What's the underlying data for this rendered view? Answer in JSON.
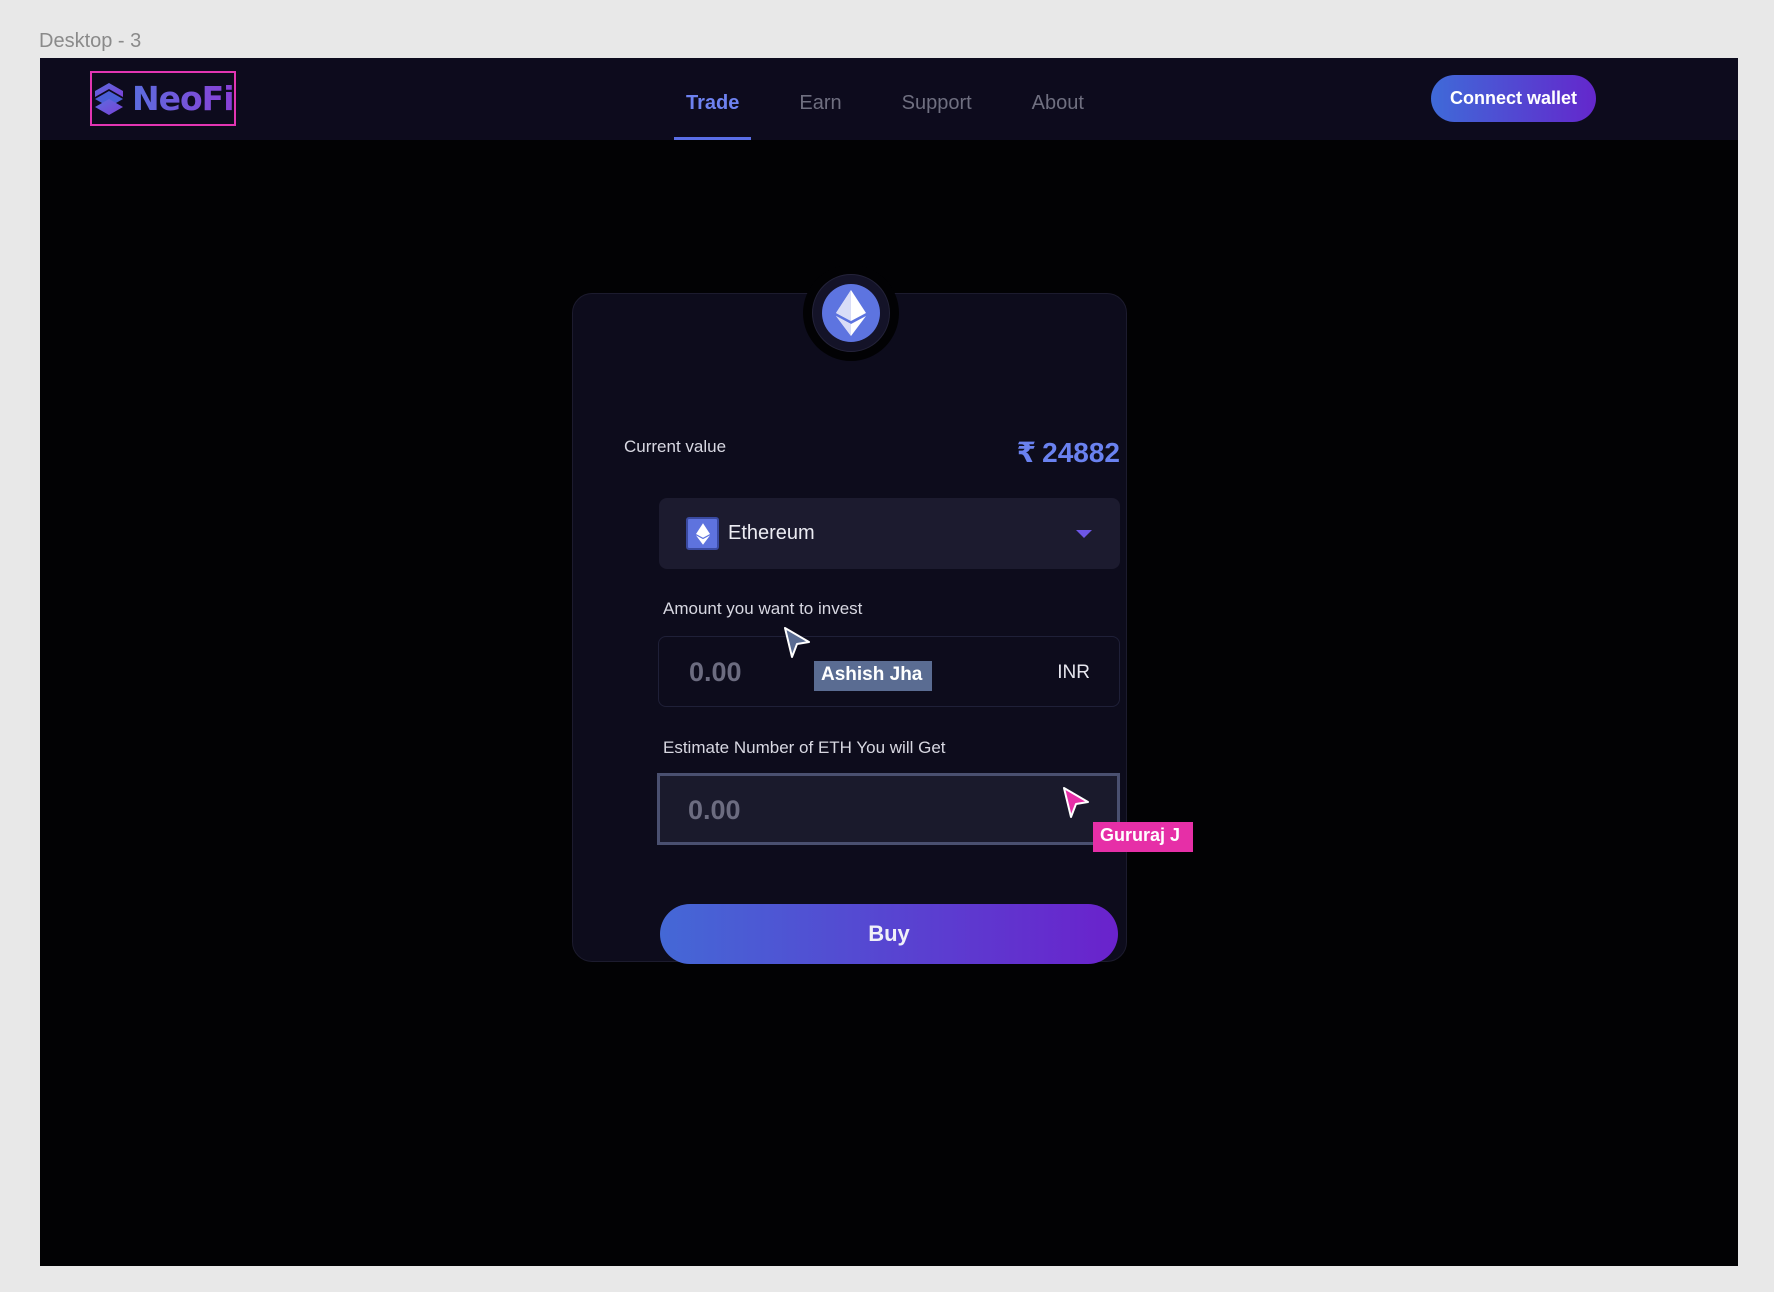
{
  "frame": {
    "label": "Desktop - 3"
  },
  "brand": {
    "name": "NeoFi",
    "accent_color": "#6a5ae0"
  },
  "nav": {
    "tabs": [
      {
        "label": "Trade",
        "active": true
      },
      {
        "label": "Earn",
        "active": false
      },
      {
        "label": "Support",
        "active": false
      },
      {
        "label": "About",
        "active": false
      }
    ],
    "connect_label": "Connect wallet"
  },
  "card": {
    "coin_icon": "ethereum-icon",
    "current_value_label": "Current value",
    "currency_symbol": "₹",
    "current_value": "24882",
    "selected_coin": "Ethereum",
    "amount_label": "Amount you want to invest",
    "amount_value": "0.00",
    "amount_unit": "INR",
    "estimate_label": "Estimate Number of ETH You will Get",
    "estimate_value": "0.00",
    "buy_label": "Buy"
  },
  "collaborators": [
    {
      "name": "Ashish Jha",
      "color": "#5a6c92"
    },
    {
      "name": "Gururaj J",
      "color": "#e62fa7"
    }
  ]
}
